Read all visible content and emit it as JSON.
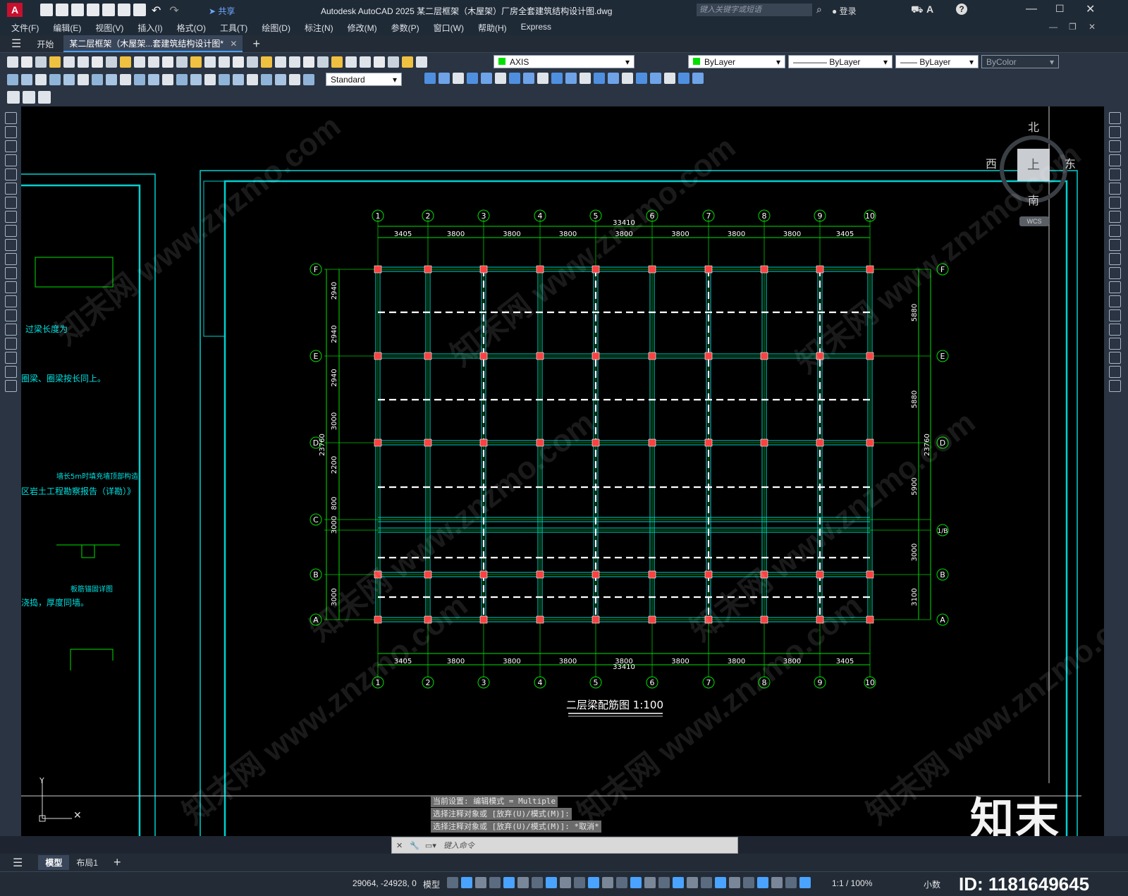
{
  "app": {
    "logo": "A",
    "title": "Autodesk AutoCAD 2025    某二层框架（木屋架）厂房全套建筑结构设计图.dwg",
    "share": "共享",
    "search_placeholder": "键入关键字或短语",
    "login": "登录"
  },
  "menu": [
    "文件(F)",
    "编辑(E)",
    "视图(V)",
    "插入(I)",
    "格式(O)",
    "工具(T)",
    "绘图(D)",
    "标注(N)",
    "修改(M)",
    "参数(P)",
    "窗口(W)",
    "帮助(H)",
    "Express"
  ],
  "tabs": {
    "start": "开始",
    "doc": "某二层框架（木屋架...套建筑结构设计图*"
  },
  "toolbar": {
    "layer": "AXIS",
    "color": "ByLayer",
    "linetype": "ByLayer",
    "lineweight": "ByLayer",
    "plotstyle": "ByColor",
    "textstyle": "Standard"
  },
  "viewcube": {
    "north": "北",
    "south": "南",
    "west": "西",
    "east": "东",
    "top": "上",
    "wcs": "WCS"
  },
  "drawing": {
    "title": "二层梁配筋图  1:100",
    "axes_top": [
      "1",
      "2",
      "3",
      "4",
      "5",
      "6",
      "7",
      "8",
      "9",
      "10"
    ],
    "axes_side": [
      "F",
      "E",
      "D",
      "C",
      "1/B",
      "B",
      "A"
    ],
    "spans": [
      "3405",
      "3800",
      "3800",
      "3800",
      "3800",
      "3800",
      "3800",
      "3800",
      "3405"
    ],
    "total": "33410",
    "left_dims": [
      "2940",
      "2940",
      "2940",
      "3000",
      "2200",
      "800",
      "3000",
      "3000"
    ],
    "left_total": "23760",
    "right_dims": [
      "5880",
      "5880",
      "5900",
      "3000",
      "3100"
    ],
    "right_total": "23760",
    "left_notes": [
      "过梁长度为",
      "圈梁、圈梁按长同上。",
      "墙长5m时填充墙顶部构造",
      "区岩土工程勘察报告（详勘）》",
      "板筋锚固详图",
      "浇捣，厚度同墙。"
    ]
  },
  "command": {
    "lines": [
      "当前设置: 编辑模式 = Multiple",
      "选择注释对象或 [放弃(U)/模式(M)]:",
      "选择注释对象或 [放弃(U)/模式(M)]: *取消*"
    ],
    "placeholder": "键入命令"
  },
  "layouts": {
    "model": "模型",
    "layout1": "布局1"
  },
  "status": {
    "coords": "29064, -24928, 0",
    "model": "模型",
    "scale": "1:1 / 100%",
    "units": "小数"
  },
  "watermark": {
    "brand": "知末",
    "id": "ID: 1181649645",
    "site": "知末网 www.znzmo.com"
  }
}
